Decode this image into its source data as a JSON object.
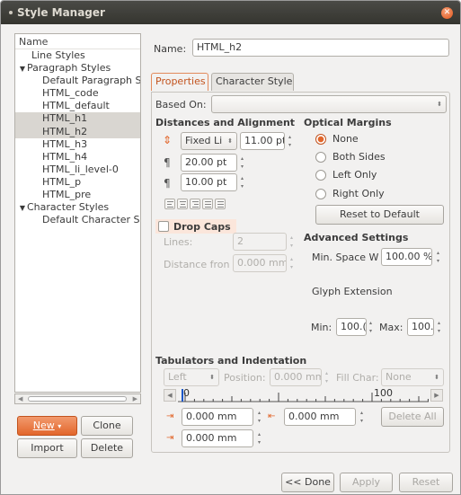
{
  "window": {
    "title": "Style Manager"
  },
  "tree": {
    "header": "Name",
    "items": [
      {
        "label": "Line Styles",
        "level": 1,
        "expander": "",
        "selected": false
      },
      {
        "label": "Paragraph Styles",
        "level": 0,
        "expander": "▼",
        "selected": false
      },
      {
        "label": "Default Paragraph S",
        "level": 2,
        "expander": "",
        "selected": false
      },
      {
        "label": "HTML_code",
        "level": 2,
        "expander": "",
        "selected": false
      },
      {
        "label": "HTML_default",
        "level": 2,
        "expander": "",
        "selected": false
      },
      {
        "label": "HTML_h1",
        "level": 2,
        "expander": "",
        "selected": true
      },
      {
        "label": "HTML_h2",
        "level": 2,
        "expander": "",
        "selected": true
      },
      {
        "label": "HTML_h3",
        "level": 2,
        "expander": "",
        "selected": false
      },
      {
        "label": "HTML_h4",
        "level": 2,
        "expander": "",
        "selected": false
      },
      {
        "label": "HTML_li_level-0",
        "level": 2,
        "expander": "",
        "selected": false
      },
      {
        "label": "HTML_p",
        "level": 2,
        "expander": "",
        "selected": false
      },
      {
        "label": "HTML_pre",
        "level": 2,
        "expander": "",
        "selected": false
      },
      {
        "label": "Character Styles",
        "level": 0,
        "expander": "▼",
        "selected": false
      },
      {
        "label": "Default Character S",
        "level": 2,
        "expander": "",
        "selected": false
      }
    ]
  },
  "left_buttons": {
    "new": "New",
    "clone": "Clone",
    "import": "Import",
    "delete": "Delete"
  },
  "name": {
    "label": "Name:",
    "value": "HTML_h2"
  },
  "tabs": {
    "properties": "Properties",
    "character_style": "Character Style"
  },
  "based_on": {
    "label": "Based On:",
    "value": ""
  },
  "distances": {
    "heading": "Distances and Alignment",
    "line_spacing_mode": "Fixed Li",
    "line_spacing": "11.00 pt",
    "space_above": "20.00 pt",
    "space_below": "10.00 pt"
  },
  "optical_margins": {
    "heading": "Optical Margins",
    "options": [
      "None",
      "Both Sides",
      "Left Only",
      "Right Only"
    ],
    "selected": "None",
    "reset": "Reset to Default"
  },
  "drop_caps": {
    "label": "Drop Caps",
    "lines_label": "Lines:",
    "lines_value": "2",
    "distance_label": "Distance fron",
    "distance_value": "0.000 mm"
  },
  "advanced": {
    "heading": "Advanced Settings",
    "min_space_label": "Min. Space W",
    "min_space_value": "100.00 %",
    "glyph_label": "Glyph Extension",
    "min_label": "Min:",
    "min_value": "100.(",
    "max_label": "Max:",
    "max_value": "100."
  },
  "tabs_indent": {
    "heading": "Tabulators and Indentation",
    "align_value": "Left",
    "position_label": "Position:",
    "position_value": "0.000 mm",
    "fill_label": "Fill Char:",
    "fill_value": "None",
    "ruler_zero": "0",
    "ruler_mark": "100",
    "first_indent": "0.000 mm",
    "right_indent": "0.000 mm",
    "left_indent": "0.000 mm",
    "delete_all": "Delete All"
  },
  "bottom_buttons": {
    "done": "<< Done",
    "apply": "Apply",
    "reset": "Reset"
  },
  "colors": {
    "accent": "#e2662b",
    "titlebar": "#3c3b37"
  }
}
